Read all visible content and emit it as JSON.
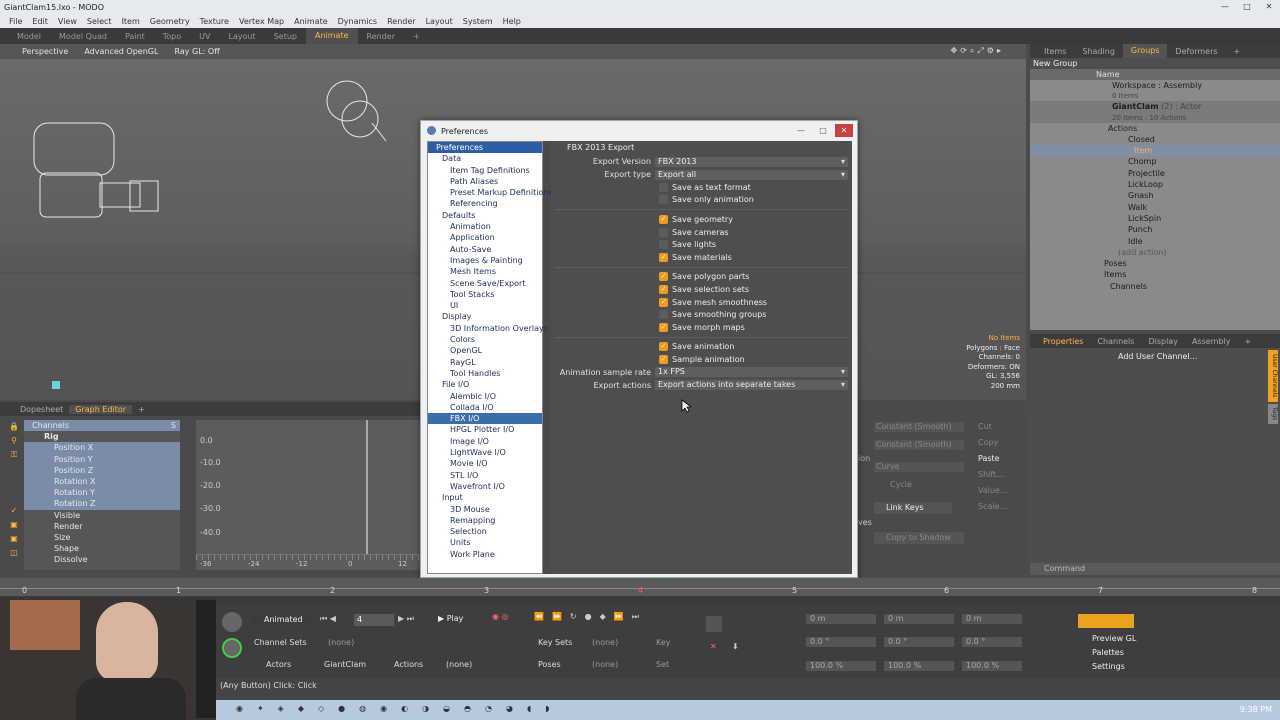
{
  "window": {
    "title": "GiantClam15.lxo - MODO",
    "min": "—",
    "max": "□",
    "close": "✕"
  },
  "menu": [
    "File",
    "Edit",
    "View",
    "Select",
    "Item",
    "Geometry",
    "Texture",
    "Vertex Map",
    "Animate",
    "Dynamics",
    "Render",
    "Layout",
    "System",
    "Help"
  ],
  "layout_tabs": [
    "Model",
    "Model Quad",
    "Paint",
    "Topo",
    "UV",
    "Layout",
    "Setup",
    "Animate",
    "Render",
    "+"
  ],
  "viewport": {
    "toolbar": [
      "Perspective",
      "Advanced OpenGL",
      "Ray GL: Off"
    ],
    "info": {
      "items": "No Items",
      "polygons": "Polygons : Face",
      "channels": "Channels: 0",
      "deformers": "Deformers: ON",
      "gl": "GL: 3,556",
      "dist": "200 mm"
    }
  },
  "groups_panel": {
    "tabs": [
      "Items",
      "Shading",
      "Groups",
      "Deformers",
      "+"
    ],
    "new_group": "New Group",
    "name_header": "Name",
    "rows": [
      {
        "label": "Workspace : Assembly",
        "sub": "0 Items"
      },
      {
        "label": "GiantClam",
        "sub": "20 Items : 10 Actions",
        "tag": "(2) : Actor"
      },
      {
        "label": "Actions"
      },
      {
        "label": "Closed"
      },
      {
        "label": "Item"
      },
      {
        "label": "Chomp"
      },
      {
        "label": "Projectile"
      },
      {
        "label": "LickLoop"
      },
      {
        "label": "Gnash"
      },
      {
        "label": "Walk"
      },
      {
        "label": "LickSpin"
      },
      {
        "label": "Punch"
      },
      {
        "label": "Idle"
      },
      {
        "label": "(add action)"
      },
      {
        "label": "Poses"
      },
      {
        "label": "Items"
      },
      {
        "label": "Channels"
      }
    ]
  },
  "properties_panel": {
    "tabs": [
      "Properties",
      "Channels",
      "Display",
      "Assembly",
      "+"
    ],
    "add_channel": "Add User Channel...",
    "side_tabs": [
      "User Channels",
      "Tags"
    ]
  },
  "command_bar": {
    "placeholder": "Command"
  },
  "graph_editor": {
    "tabs": [
      "Dopesheet",
      "Graph Editor",
      "+"
    ],
    "channels_header": "Channels",
    "s_header": "S",
    "channels": [
      "Rig",
      "Position X",
      "Position Y",
      "Position Z",
      "Rotation X",
      "Rotation Y",
      "Rotation Z",
      "Visible",
      "Render",
      "Size",
      "Shape",
      "Dissolve"
    ],
    "y_ticks": [
      "0.0",
      "-10.0",
      "-20.0",
      "-30.0",
      "-40.0"
    ],
    "x_ticks": [
      "-36",
      "-24",
      "-12",
      "0",
      "12"
    ],
    "right_tools": [
      "Cut",
      "Copy",
      "Paste",
      "Shift...",
      "Value...",
      "Scale..."
    ],
    "dropdowns": [
      "Constant (Smooth)",
      "Constant (Smooth)",
      "Curve"
    ],
    "cycle": "Cycle",
    "link_keys": "Link Keys",
    "copy_to_shadow": "Copy to Shadow",
    "ves": "ves",
    "ion": "ion"
  },
  "preferences": {
    "title": "Preferences",
    "tree": [
      {
        "label": "Preferences",
        "type": "hdr"
      },
      {
        "label": "Data",
        "type": "cat"
      },
      {
        "label": "Item Tag Definitions"
      },
      {
        "label": "Path Aliases"
      },
      {
        "label": "Preset Markup Definitions"
      },
      {
        "label": "Referencing"
      },
      {
        "label": "Defaults",
        "type": "cat"
      },
      {
        "label": "Animation"
      },
      {
        "label": "Application"
      },
      {
        "label": "Auto-Save"
      },
      {
        "label": "Images & Painting"
      },
      {
        "label": "Mesh Items"
      },
      {
        "label": "Scene Save/Export"
      },
      {
        "label": "Tool Stacks"
      },
      {
        "label": "UI"
      },
      {
        "label": "Display",
        "type": "cat"
      },
      {
        "label": "3D Information Overlays"
      },
      {
        "label": "Colors"
      },
      {
        "label": "OpenGL"
      },
      {
        "label": "RayGL"
      },
      {
        "label": "Tool Handles"
      },
      {
        "label": "File I/O",
        "type": "cat"
      },
      {
        "label": "Alembic I/O"
      },
      {
        "label": "Collada I/O"
      },
      {
        "label": "FBX I/O",
        "type": "sel"
      },
      {
        "label": "HPGL Plotter I/O"
      },
      {
        "label": "Image I/O"
      },
      {
        "label": "LightWave I/O"
      },
      {
        "label": "Movie I/O"
      },
      {
        "label": "STL I/O"
      },
      {
        "label": "Wavefront I/O"
      },
      {
        "label": "Input",
        "type": "cat"
      },
      {
        "label": "3D Mouse"
      },
      {
        "label": "Remapping"
      },
      {
        "label": "Selection"
      },
      {
        "label": "Units"
      },
      {
        "label": "Work Plane"
      }
    ],
    "panel_title": "FBX 2013 Export",
    "export_version_label": "Export Version",
    "export_version": "FBX 2013",
    "export_type_label": "Export type",
    "export_type": "Export all",
    "group1": [
      {
        "label": "Save as text format",
        "checked": false
      },
      {
        "label": "Save only animation",
        "checked": false
      }
    ],
    "group2": [
      {
        "label": "Save geometry",
        "checked": true
      },
      {
        "label": "Save cameras",
        "checked": false
      },
      {
        "label": "Save lights",
        "checked": false
      },
      {
        "label": "Save materials",
        "checked": true
      }
    ],
    "group3": [
      {
        "label": "Save polygon parts",
        "checked": true
      },
      {
        "label": "Save selection sets",
        "checked": true
      },
      {
        "label": "Save mesh smoothness",
        "checked": true
      },
      {
        "label": "Save smoothing groups",
        "checked": false
      },
      {
        "label": "Save morph maps",
        "checked": true
      }
    ],
    "group4": [
      {
        "label": "Save animation",
        "checked": true
      },
      {
        "label": "Sample animation",
        "checked": true
      }
    ],
    "sample_rate_label": "Animation sample rate",
    "sample_rate": "1x FPS",
    "export_actions_label": "Export actions",
    "export_actions": "Export actions into separate takes"
  },
  "timeline": {
    "ticks": [
      "0",
      "1",
      "2",
      "3",
      "4",
      "5",
      "6",
      "7",
      "8"
    ]
  },
  "transport": {
    "mode": "Animated",
    "frame": "4",
    "play": "Play",
    "channel_sets": "Channel Sets",
    "none1": "(none)",
    "key_sets": "Key Sets",
    "none2": "(none)",
    "key": "Key",
    "actors": "Actors",
    "actor": "GiantClam",
    "actions": "Actions",
    "none3": "(none)",
    "poses": "Poses",
    "none4": "(none)",
    "set": "Set",
    "pos": [
      "0 m",
      "0 m",
      "0 m"
    ],
    "rot": [
      "0.0 °",
      "0.0 °",
      "0.0 °"
    ],
    "scl": [
      "100.0 %",
      "100.0 %",
      "100.0 %"
    ],
    "right_menu": [
      "Preview GL",
      "Palettes",
      "Settings"
    ]
  },
  "status": {
    "text": "(Any Button) Click:",
    "action": "Click"
  },
  "taskbar": {
    "time": "9:38 PM"
  }
}
